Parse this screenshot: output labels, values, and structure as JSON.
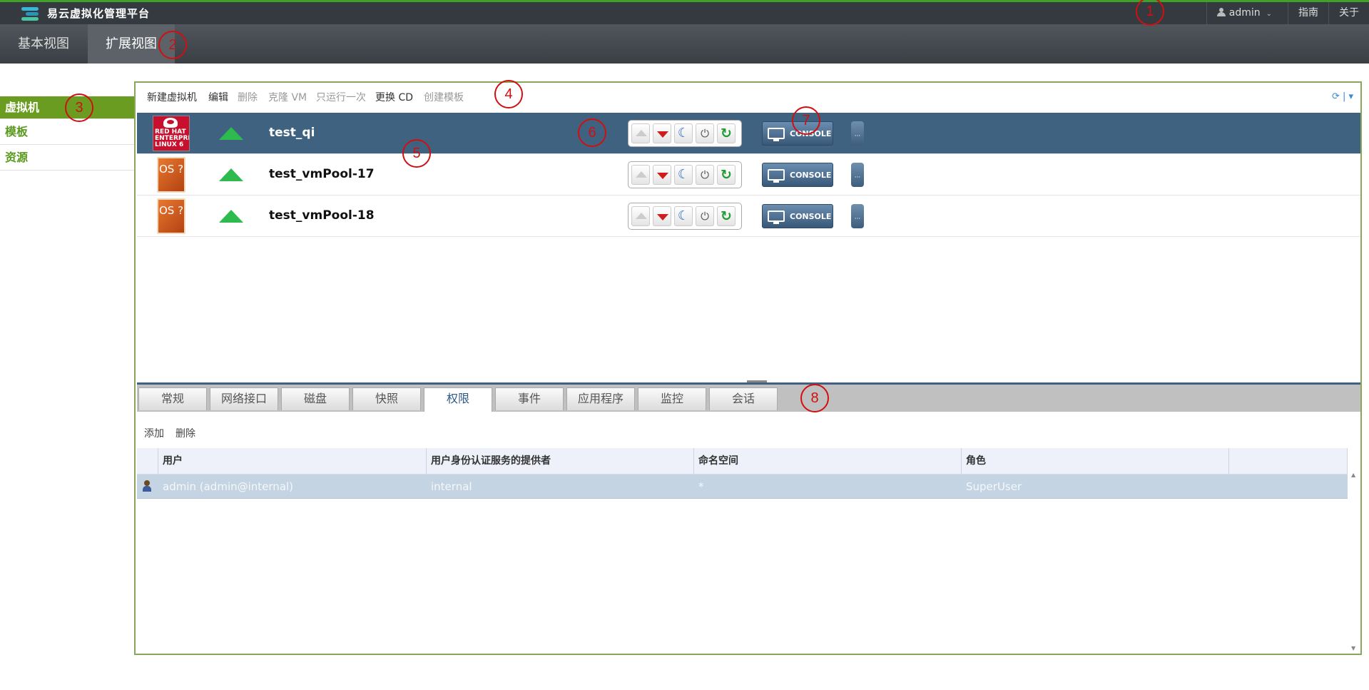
{
  "app": {
    "title": "易云虚拟化管理平台"
  },
  "topnav": {
    "user": "admin",
    "guide": "指南",
    "about": "关于"
  },
  "mainnav": [
    {
      "label": "基本视图"
    },
    {
      "label": "扩展视图"
    }
  ],
  "sidebar": [
    {
      "label": "虚拟机"
    },
    {
      "label": "模板"
    },
    {
      "label": "资源"
    }
  ],
  "toolbar": {
    "new_vm": "新建虚拟机",
    "edit": "编辑",
    "delete": "删除",
    "clone": "克隆 VM",
    "run_once": "只运行一次",
    "change_cd": "更换 CD",
    "create_template": "创建模板"
  },
  "vms": [
    {
      "name": "test_qi",
      "os": "RED HAT ENTERPRISE LINUX 6",
      "status": "up"
    },
    {
      "name": "test_vmPool-17",
      "os": "OS ?",
      "status": "up"
    },
    {
      "name": "test_vmPool-18",
      "os": "OS ?",
      "status": "up"
    }
  ],
  "console_label": "CONSOLE",
  "more_label": "···",
  "detail_tabs": [
    {
      "label": "常规"
    },
    {
      "label": "网络接口"
    },
    {
      "label": "磁盘"
    },
    {
      "label": "快照"
    },
    {
      "label": "权限"
    },
    {
      "label": "事件"
    },
    {
      "label": "应用程序"
    },
    {
      "label": "监控"
    },
    {
      "label": "会话"
    }
  ],
  "permissions": {
    "actions": {
      "add": "添加",
      "delete": "删除"
    },
    "columns": [
      "用户",
      "用户身份认证服务的提供者",
      "命名空间",
      "角色"
    ],
    "rows": [
      {
        "user": "admin (admin@internal)",
        "provider": "internal",
        "namespace": "*",
        "role": "SuperUser"
      }
    ]
  },
  "markers": [
    "1",
    "2",
    "3",
    "4",
    "5",
    "6",
    "7",
    "8"
  ],
  "colors": {
    "accent_green": "#6b9c22",
    "selected_row": "#3f6280",
    "header_bg": "#343a40"
  }
}
